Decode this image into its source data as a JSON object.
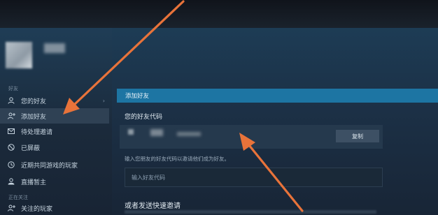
{
  "sidebar": {
    "section_friends": "好友",
    "section_following": "正在关注",
    "items": [
      {
        "label": "您的好友",
        "icon": "person-icon",
        "chevron": "›"
      },
      {
        "label": "添加好友",
        "icon": "add-person-icon",
        "active": true
      },
      {
        "label": "待处理邀请",
        "icon": "mail-icon"
      },
      {
        "label": "已屏蔽",
        "icon": "block-icon"
      },
      {
        "label": "近期共同游戏的玩家",
        "icon": "clock-icon"
      },
      {
        "label": "直播暂主",
        "icon": "broadcast-icon"
      },
      {
        "label": "关注的玩家",
        "icon": "person-follow-icon"
      }
    ]
  },
  "main": {
    "header": "添加好友",
    "code_label": "您的好友代码",
    "copy_button": "复制",
    "hint": "输入您朋友的好友代码以邀请他们成为好友。",
    "input_placeholder": "输入好友代码",
    "invite_title": "或者发送快速邀请"
  },
  "colors": {
    "accent_header": "#1d75a3",
    "annotation_arrow": "#e8733a",
    "active_nav": "#2f4154"
  }
}
